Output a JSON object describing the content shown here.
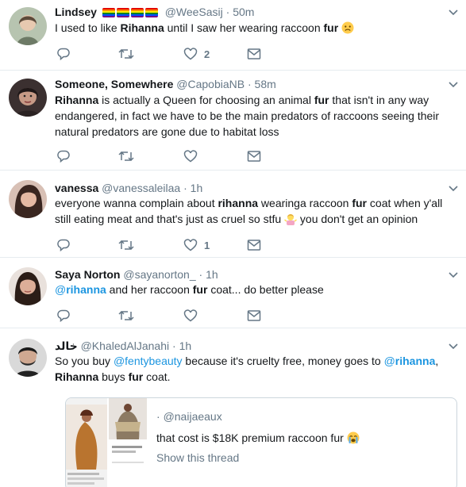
{
  "tweets": [
    {
      "name": "Lindsey",
      "handle": "@WeeSasij",
      "time": "50m",
      "text_html": "I used to like <b>Rihanna</b> until I saw her wearing raccoon <b>fur</b> ",
      "emoji": "slightly-frowning-face",
      "likes": "2",
      "retweets": ""
    },
    {
      "name": "Someone, Somewhere",
      "handle": "@CapobiaNB",
      "time": "58m",
      "text_html": "<b>Rihanna</b> is actually a Queen for choosing an animal <b>fur</b> that isn't in any way endangered, in fact we have to be the main predators of raccoons seeing their natural predators are gone due to habitat loss",
      "likes": "",
      "retweets": ""
    },
    {
      "name": "vanessa",
      "handle": "@vanessaleilaa",
      "time": "1h",
      "text_html": "everyone wanna complain about <b>rihanna</b> wearinga raccoon <b>fur</b> coat when y'all still eating meat and that's just as cruel so stfu ",
      "text_after_emoji": " you don't get an opinion",
      "emoji": "woman-shrugging",
      "likes": "1",
      "retweets": ""
    },
    {
      "name": "Saya Norton",
      "handle": "@sayanorton_",
      "time": "1h",
      "text_html": "<span class=\"link\">@<b>rihanna</b></span> and her raccoon <b>fur</b> coat... do better please",
      "likes": "",
      "retweets": ""
    },
    {
      "name": "خالد",
      "handle": "@KhaledAlJanahi",
      "time": "1h",
      "text_html": "So you buy <span class=\"link\">@fentybeauty</span> because it's cruelty free, money goes to <span class=\"link\">@<b>rihanna</b></span>,<br><b>Rihanna</b> buys <b>fur</b> coat.",
      "quote": {
        "handle": "@naijaeaux",
        "text": "that cost is $18K premium raccoon fur ",
        "emoji": "loudly-crying-face",
        "show_thread": "Show this thread"
      }
    }
  ],
  "icons": {
    "reply": "reply-icon",
    "retweet": "retweet-icon",
    "like": "heart-icon",
    "message": "envelope-icon",
    "caret": "chevron-down-icon"
  },
  "colors": {
    "icon": "#657786",
    "link": "#1b95e0",
    "divider": "#e6ecf0",
    "text": "#14171a"
  }
}
